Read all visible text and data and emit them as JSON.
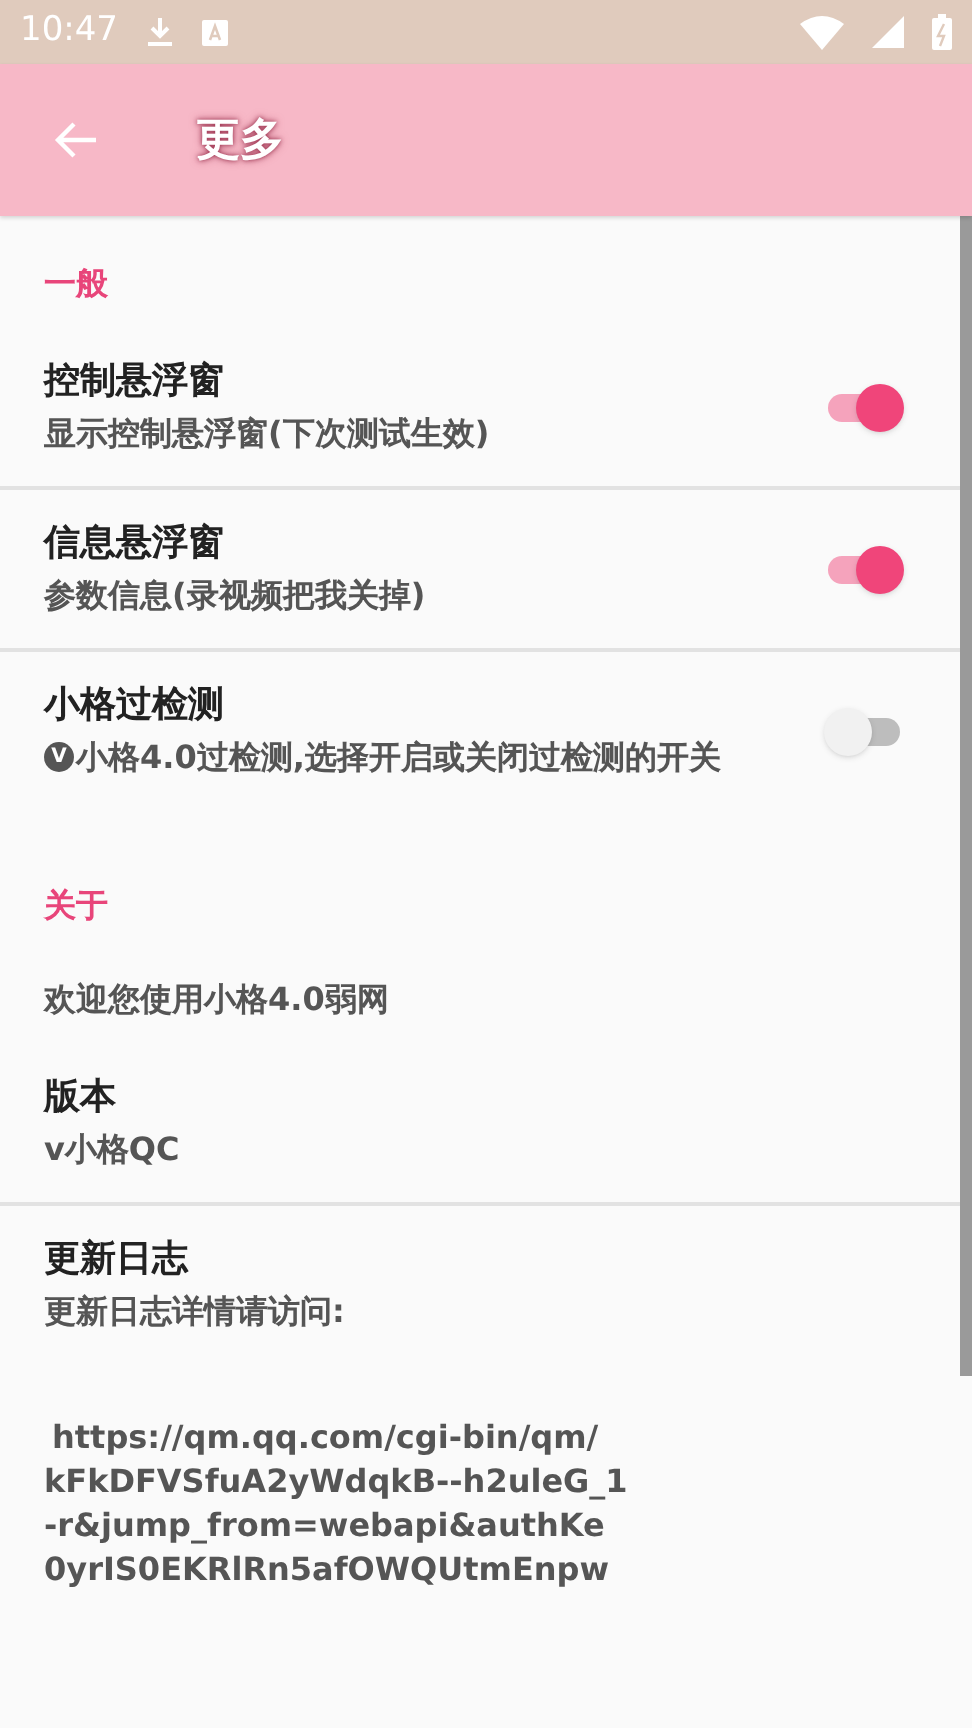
{
  "status_bar": {
    "time": "10:47"
  },
  "app_bar": {
    "title": "更多"
  },
  "sections": [
    {
      "header": "一般",
      "items": [
        {
          "kind": "switch",
          "title": "控制悬浮窗",
          "summary": "显示控制悬浮窗(下次测试生效)",
          "on": true,
          "divider": true
        },
        {
          "kind": "switch",
          "title": "信息悬浮窗",
          "summary": "参数信息(录视频把我关掉)",
          "on": true,
          "divider": true
        },
        {
          "kind": "switch",
          "title": "小格过检测",
          "summary": "小格4.0过检测,选择开启或关闭过检测的开关",
          "badge": "V",
          "on": false,
          "divider": false
        }
      ]
    },
    {
      "header": "关于",
      "items": [
        {
          "kind": "text",
          "summary": "欢迎您使用小格4.0弱网",
          "divider": false
        },
        {
          "kind": "text",
          "title": "版本",
          "summary": "v小格QC",
          "divider": true
        },
        {
          "kind": "text",
          "title": "更新日志",
          "summary": "更新日志详情请访问:",
          "divider": false
        },
        {
          "kind": "link",
          "lines": [
            "https://qm.qq.com/cgi-bin/qm/",
            "kFkDFVSfuA2yWdqkB--h2uleG_1",
            "-r&jump_from=webapi&authKe",
            "0yrIS0EKRlRn5afOWQUtmEnpw"
          ]
        }
      ]
    }
  ]
}
